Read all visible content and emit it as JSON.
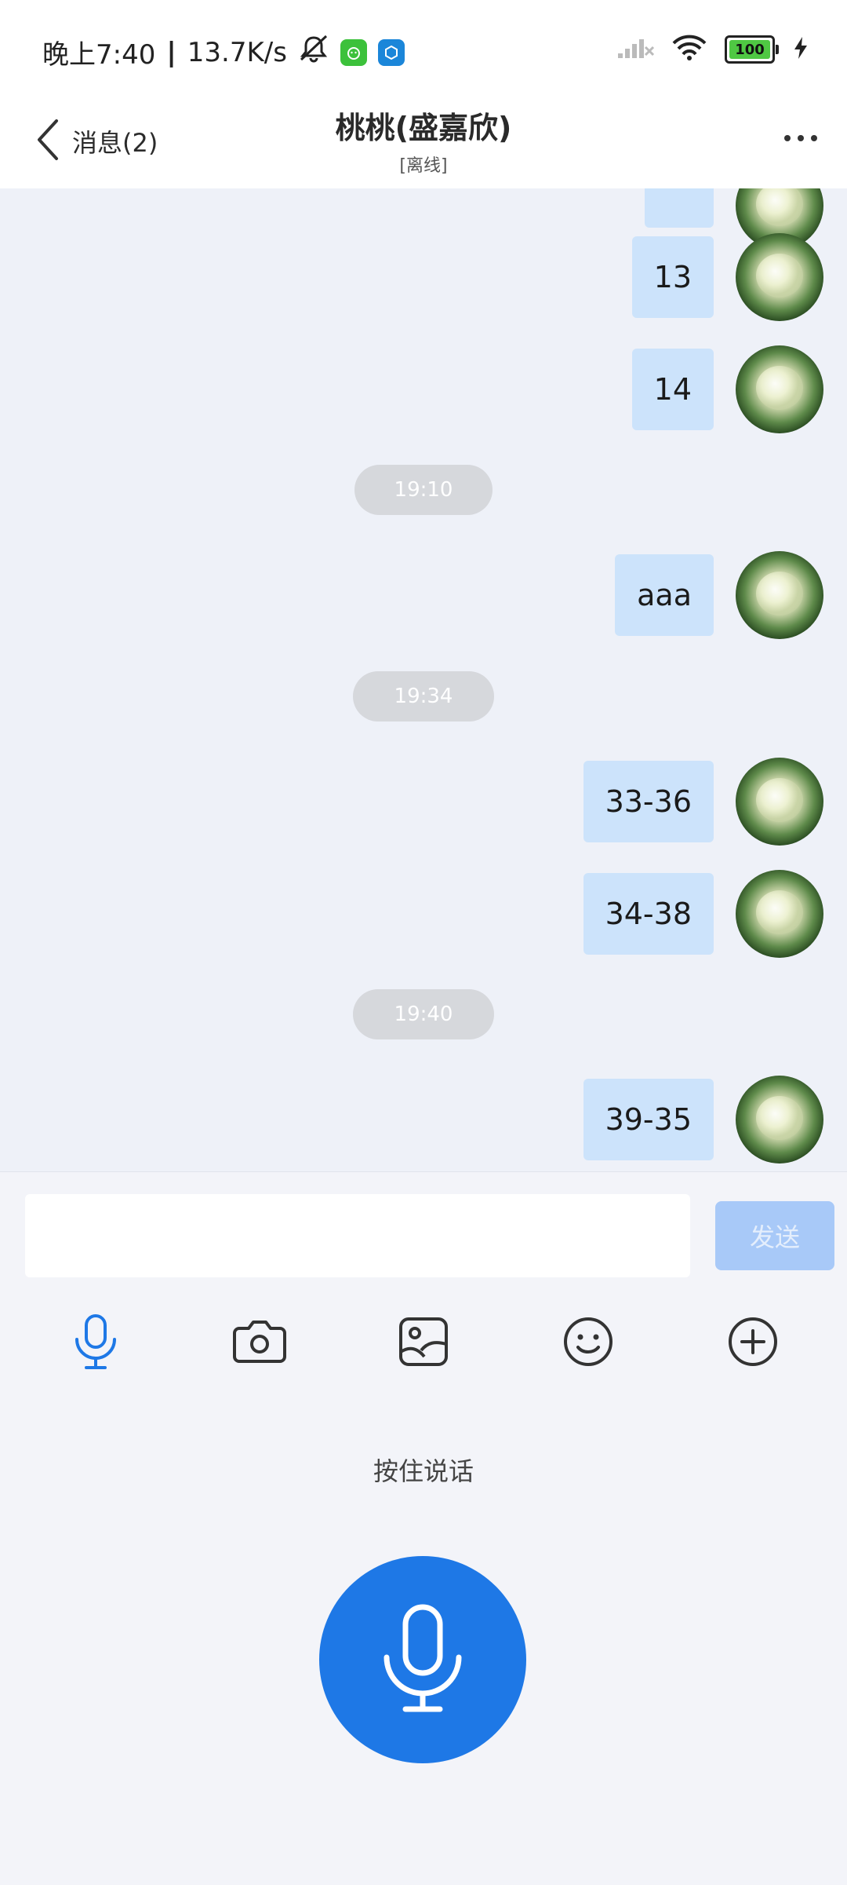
{
  "status_bar": {
    "time": "晚上7:40",
    "speed": "13.7K/s",
    "battery": "100",
    "icons": [
      "mute-bell-icon",
      "app-green-icon",
      "app-blue-icon",
      "signal-icon",
      "wifi-icon",
      "battery-icon",
      "charging-icon"
    ]
  },
  "header": {
    "back_label": "消息(2)",
    "title": "桃桃(盛嘉欣)",
    "subtitle": "[离线]"
  },
  "messages": [
    {
      "type": "msg",
      "text": "13"
    },
    {
      "type": "msg",
      "text": "14"
    },
    {
      "type": "time",
      "text": "19:10"
    },
    {
      "type": "msg",
      "text": "aaa"
    },
    {
      "type": "time",
      "text": "19:34"
    },
    {
      "type": "msg",
      "text": "33-36"
    },
    {
      "type": "msg",
      "text": "34-38"
    },
    {
      "type": "time",
      "text": "19:40"
    },
    {
      "type": "msg",
      "text": "39-35"
    }
  ],
  "composer": {
    "input_value": "",
    "send_label": "发送",
    "hold_to_talk": "按住说话",
    "tools": [
      "voice",
      "camera",
      "album",
      "emoji",
      "more"
    ]
  },
  "colors": {
    "accent": "#1e78e6",
    "bubble": "#cce3fb",
    "send_disabled": "#a8c9f8",
    "chat_bg": "#eef1f8"
  }
}
